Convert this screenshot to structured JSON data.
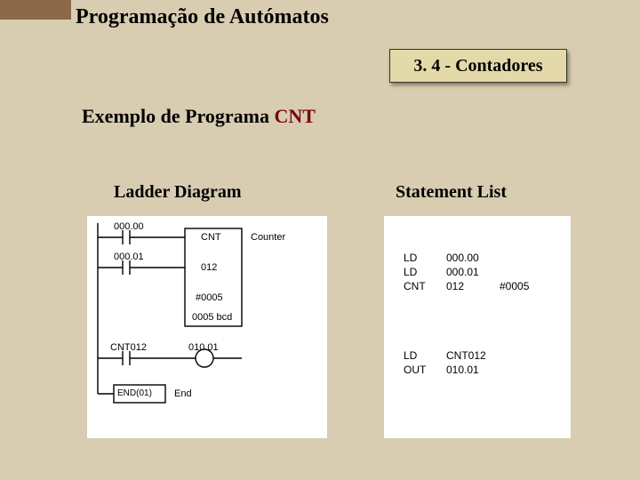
{
  "header": {
    "page_title": "Programação de Autómatos",
    "section_badge": "3. 4 - Contadores"
  },
  "example": {
    "prefix": "Exemplo de Programa ",
    "code": "CNT"
  },
  "columns": {
    "ladder_heading": "Ladder Diagram",
    "stl_heading": "Statement List"
  },
  "ladder": {
    "addr1": "000.00",
    "addr2": "000.01",
    "block_top": "CNT",
    "block_mid": "012",
    "block_val": "#0005",
    "block_bcd": "0005 bcd",
    "right_label": "Counter",
    "rung2_contact": "CNT012",
    "rung2_coil": "010.01",
    "end_box": "END(01)",
    "end_label": "End"
  },
  "stl": {
    "block1": [
      {
        "op": "LD",
        "a": "000.00",
        "b": ""
      },
      {
        "op": "LD",
        "a": "000.01",
        "b": ""
      },
      {
        "op": "CNT",
        "a": "012",
        "b": "#0005"
      }
    ],
    "block2": [
      {
        "op": "LD",
        "a": "CNT012"
      },
      {
        "op": "OUT",
        "a": "010.01"
      }
    ]
  }
}
